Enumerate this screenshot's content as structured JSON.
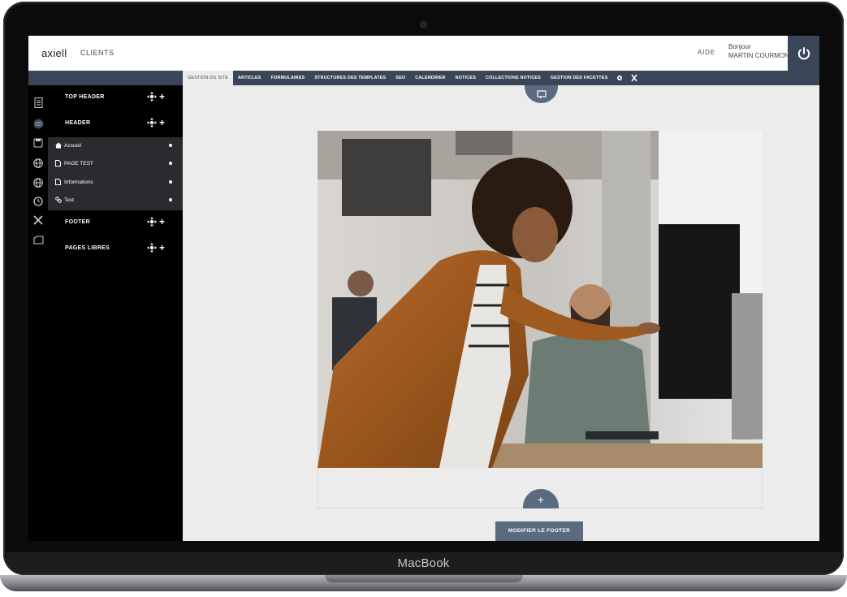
{
  "device": {
    "brand": "MacBook"
  },
  "header": {
    "logo": "axiell",
    "clients_label": "CLIENTS",
    "help_label": "AIDE",
    "greeting": "Bonjour",
    "user_name": "MARTIN COURMONT",
    "power_icon": "power-icon"
  },
  "nav": {
    "tabs": [
      {
        "label": "GESTION DU SITE",
        "active": true
      },
      {
        "label": "ARTICLES"
      },
      {
        "label": "FORMULAIRES"
      },
      {
        "label": "STRUCTURES DES TEMPLATES"
      },
      {
        "label": "SEO"
      },
      {
        "label": "CALENDRIER"
      },
      {
        "label": "NOTICES"
      },
      {
        "label": "COLLECTIONS NOTICES"
      },
      {
        "label": "GESTION DES FACETTES"
      }
    ],
    "icon_tabs": [
      "settings-cog-icon",
      "tools-icon"
    ]
  },
  "iconbar": {
    "icons": [
      "document-icon",
      "eye-icon",
      "save-icon",
      "globe-icon",
      "globe-icon",
      "clock-icon",
      "tools-icon",
      "folder-icon"
    ]
  },
  "sidebar": {
    "sections": [
      {
        "label": "TOP HEADER"
      },
      {
        "label": "HEADER"
      },
      {
        "label": "FOOTER"
      },
      {
        "label": "PAGES LIBRES"
      }
    ],
    "pages": [
      {
        "label": "Accueil",
        "icon": "home-icon"
      },
      {
        "label": "PAGE TEST",
        "icon": "page-icon"
      },
      {
        "label": "Informations",
        "icon": "page-icon"
      },
      {
        "label": "Test",
        "icon": "link-icon"
      }
    ]
  },
  "main": {
    "hero_image": "photo-office-woman-pointing-at-screen",
    "add_block_label": "+",
    "footer_button": "MODIFIER LE FOOTER"
  },
  "colors": {
    "primary": "#3a4658",
    "accent": "#5a6a80",
    "canvas": "#ececec"
  }
}
